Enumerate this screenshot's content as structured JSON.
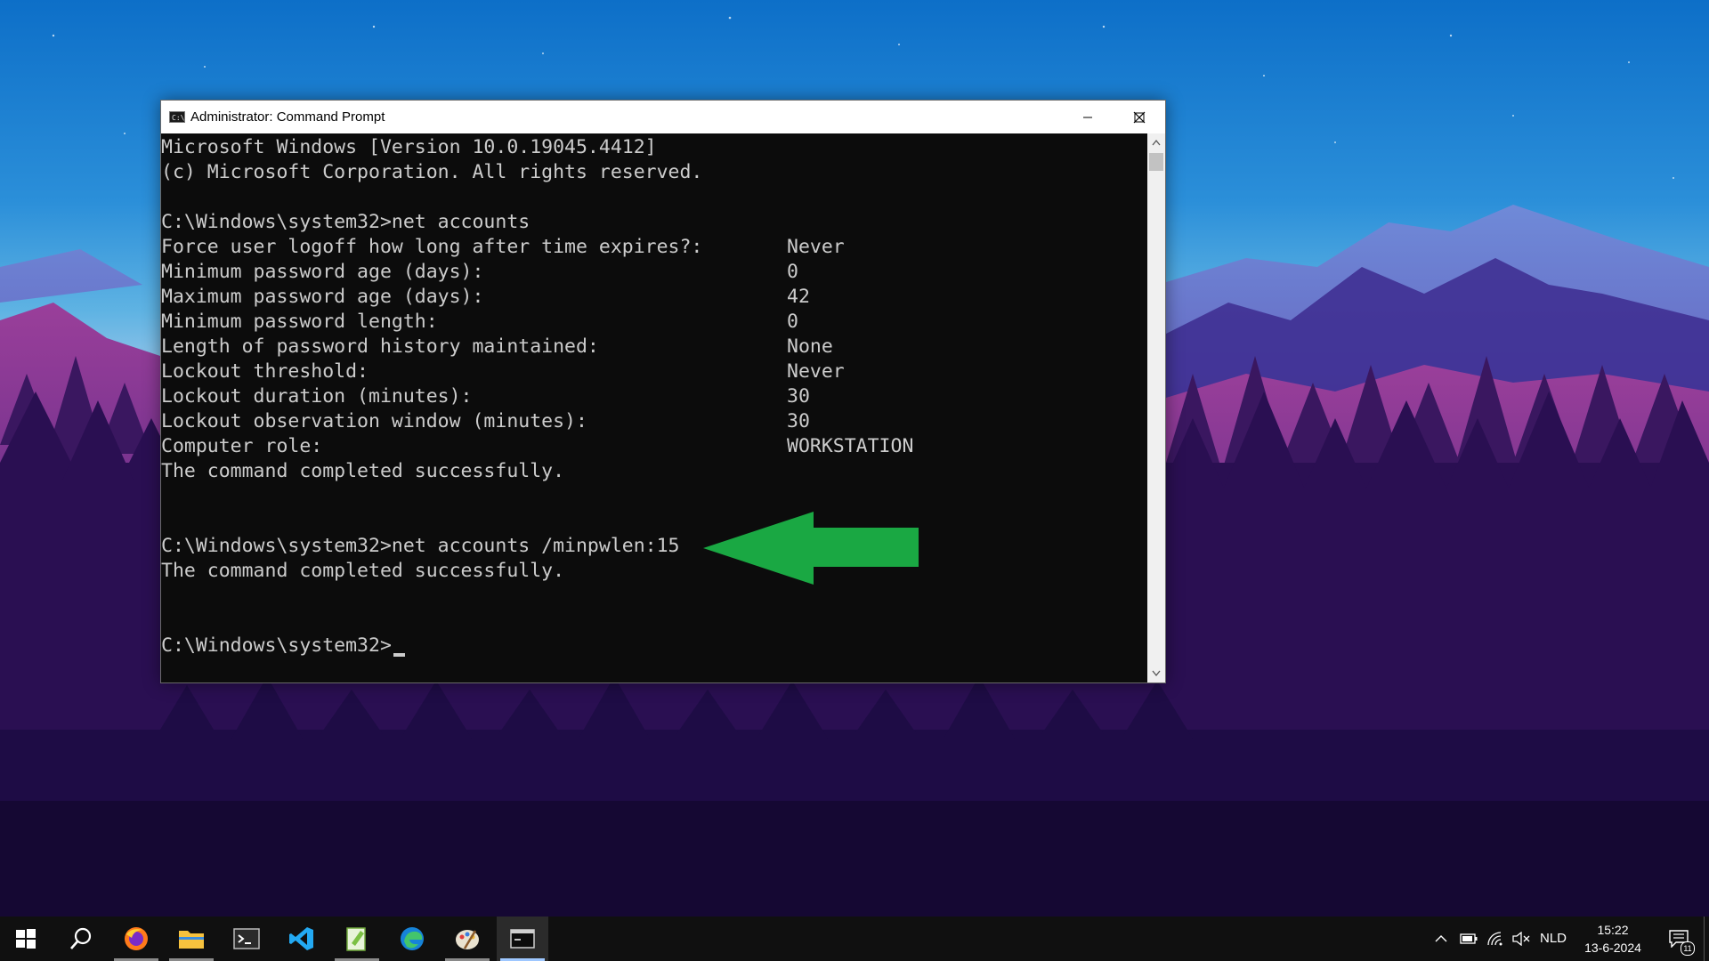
{
  "window": {
    "title": "Administrator: Command Prompt",
    "icon": "cmd-icon"
  },
  "console": {
    "lines": [
      "Microsoft Windows [Version 10.0.19045.4412]",
      "(c) Microsoft Corporation. All rights reserved.",
      "",
      "C:\\Windows\\system32>net accounts"
    ],
    "settings": [
      {
        "label": "Force user logoff how long after time expires?:",
        "value": "Never"
      },
      {
        "label": "Minimum password age (days):",
        "value": "0"
      },
      {
        "label": "Maximum password age (days):",
        "value": "42"
      },
      {
        "label": "Minimum password length:",
        "value": "0"
      },
      {
        "label": "Length of password history maintained:",
        "value": "None"
      },
      {
        "label": "Lockout threshold:",
        "value": "Never"
      },
      {
        "label": "Lockout duration (minutes):",
        "value": "30"
      },
      {
        "label": "Lockout observation window (minutes):",
        "value": "30"
      },
      {
        "label": "Computer role:",
        "value": "WORKSTATION"
      }
    ],
    "completed_1": "The command completed successfully.",
    "command_2": "C:\\Windows\\system32>net accounts /minpwlen:15",
    "completed_2": "The command completed successfully.",
    "prompt": "C:\\Windows\\system32>"
  },
  "annotation": {
    "arrow_color": "#1aa843"
  },
  "taskbar": {
    "apps": [
      "start-icon",
      "search-icon",
      "firefox-icon",
      "file-explorer-icon",
      "terminal-icon",
      "vscode-icon",
      "notepad-plus-icon",
      "edge-icon",
      "paint-icon",
      "command-prompt-icon"
    ],
    "language": "NLD",
    "time": "15:22",
    "date": "13-6-2024",
    "notification_count": "11"
  }
}
